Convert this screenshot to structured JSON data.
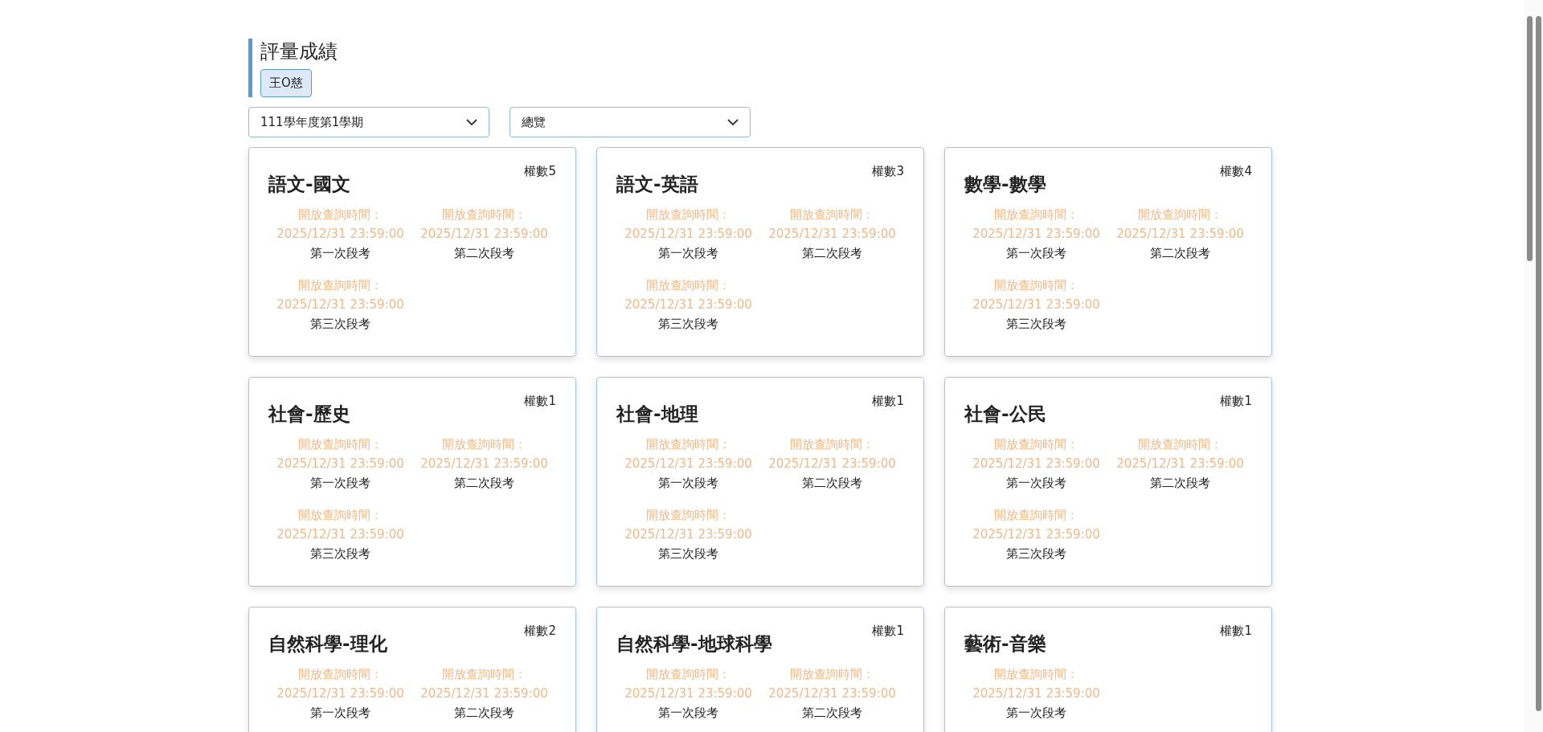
{
  "page_title": "評量成績",
  "student": {
    "label": "王O慈"
  },
  "filters": [
    {
      "value": "111學年度第1學期"
    },
    {
      "value": "總覽"
    }
  ],
  "subjects": [
    {
      "name": "語文-國文",
      "weight": "權數5",
      "exams": [
        {
          "open_label": "開放查詢時間：",
          "open_time": "2025/12/31 23:59:00",
          "name": "第一次段考"
        },
        {
          "open_label": "開放查詢時間：",
          "open_time": "2025/12/31 23:59:00",
          "name": "第二次段考"
        },
        {
          "open_label": "開放查詢時間：",
          "open_time": "2025/12/31 23:59:00",
          "name": "第三次段考"
        }
      ]
    },
    {
      "name": "語文-英語",
      "weight": "權數3",
      "exams": [
        {
          "open_label": "開放查詢時間：",
          "open_time": "2025/12/31 23:59:00",
          "name": "第一次段考"
        },
        {
          "open_label": "開放查詢時間：",
          "open_time": "2025/12/31 23:59:00",
          "name": "第二次段考"
        },
        {
          "open_label": "開放查詢時間：",
          "open_time": "2025/12/31 23:59:00",
          "name": "第三次段考"
        }
      ]
    },
    {
      "name": "數學-數學",
      "weight": "權數4",
      "exams": [
        {
          "open_label": "開放查詢時間：",
          "open_time": "2025/12/31 23:59:00",
          "name": "第一次段考"
        },
        {
          "open_label": "開放查詢時間：",
          "open_time": "2025/12/31 23:59:00",
          "name": "第二次段考"
        },
        {
          "open_label": "開放查詢時間：",
          "open_time": "2025/12/31 23:59:00",
          "name": "第三次段考"
        }
      ]
    },
    {
      "name": "社會-歷史",
      "weight": "權數1",
      "exams": [
        {
          "open_label": "開放查詢時間：",
          "open_time": "2025/12/31 23:59:00",
          "name": "第一次段考"
        },
        {
          "open_label": "開放查詢時間：",
          "open_time": "2025/12/31 23:59:00",
          "name": "第二次段考"
        },
        {
          "open_label": "開放查詢時間：",
          "open_time": "2025/12/31 23:59:00",
          "name": "第三次段考"
        }
      ]
    },
    {
      "name": "社會-地理",
      "weight": "權數1",
      "exams": [
        {
          "open_label": "開放查詢時間：",
          "open_time": "2025/12/31 23:59:00",
          "name": "第一次段考"
        },
        {
          "open_label": "開放查詢時間：",
          "open_time": "2025/12/31 23:59:00",
          "name": "第二次段考"
        },
        {
          "open_label": "開放查詢時間：",
          "open_time": "2025/12/31 23:59:00",
          "name": "第三次段考"
        }
      ]
    },
    {
      "name": "社會-公民",
      "weight": "權數1",
      "exams": [
        {
          "open_label": "開放查詢時間：",
          "open_time": "2025/12/31 23:59:00",
          "name": "第一次段考"
        },
        {
          "open_label": "開放查詢時間：",
          "open_time": "2025/12/31 23:59:00",
          "name": "第二次段考"
        },
        {
          "open_label": "開放查詢時間：",
          "open_time": "2025/12/31 23:59:00",
          "name": "第三次段考"
        }
      ]
    },
    {
      "name": "自然科學-理化",
      "weight": "權數2",
      "exams": [
        {
          "open_label": "開放查詢時間：",
          "open_time": "2025/12/31 23:59:00",
          "name": "第一次段考"
        },
        {
          "open_label": "開放查詢時間：",
          "open_time": "2025/12/31 23:59:00",
          "name": "第二次段考"
        }
      ]
    },
    {
      "name": "自然科學-地球科學",
      "weight": "權數1",
      "exams": [
        {
          "open_label": "開放查詢時間：",
          "open_time": "2025/12/31 23:59:00",
          "name": "第一次段考"
        },
        {
          "open_label": "開放查詢時間：",
          "open_time": "2025/12/31 23:59:00",
          "name": "第二次段考"
        }
      ]
    },
    {
      "name": "藝術-音樂",
      "weight": "權數1",
      "exams": [
        {
          "open_label": "開放查詢時間：",
          "open_time": "2025/12/31 23:59:00",
          "name": "第一次段考"
        }
      ]
    }
  ]
}
